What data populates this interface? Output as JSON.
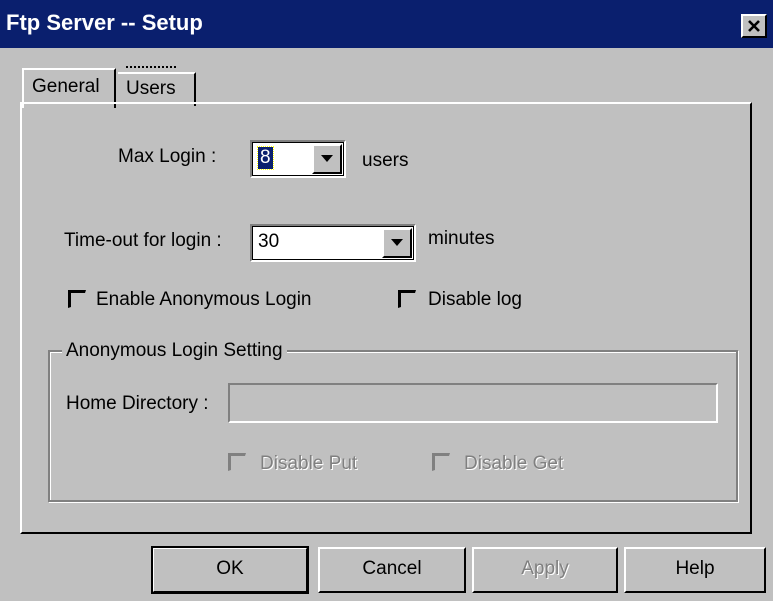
{
  "window": {
    "title": "Ftp Server -- Setup",
    "close_icon": "close-icon"
  },
  "tabs": [
    {
      "label": "General",
      "active": true
    },
    {
      "label": "Users",
      "active": false
    }
  ],
  "general": {
    "max_login": {
      "label": "Max Login :",
      "value": "8",
      "unit": "users"
    },
    "timeout": {
      "label": "Time-out for login :",
      "value": "30",
      "unit": "minutes"
    },
    "enable_anonymous": {
      "label": "Enable Anonymous Login",
      "checked": false
    },
    "disable_log": {
      "label": "Disable log",
      "checked": false
    }
  },
  "anonymous_group": {
    "legend": "Anonymous Login Setting",
    "home_directory": {
      "label": "Home Directory :",
      "value": ""
    },
    "disable_put": {
      "label": "Disable Put",
      "checked": false,
      "enabled": false
    },
    "disable_get": {
      "label": "Disable Get",
      "checked": false,
      "enabled": false
    }
  },
  "buttons": {
    "ok": "OK",
    "cancel": "Cancel",
    "apply": "Apply",
    "help": "Help"
  },
  "colors": {
    "titlebar": "#0a1f6e",
    "face": "#c0c0c0",
    "disabled_text": "#808080"
  }
}
